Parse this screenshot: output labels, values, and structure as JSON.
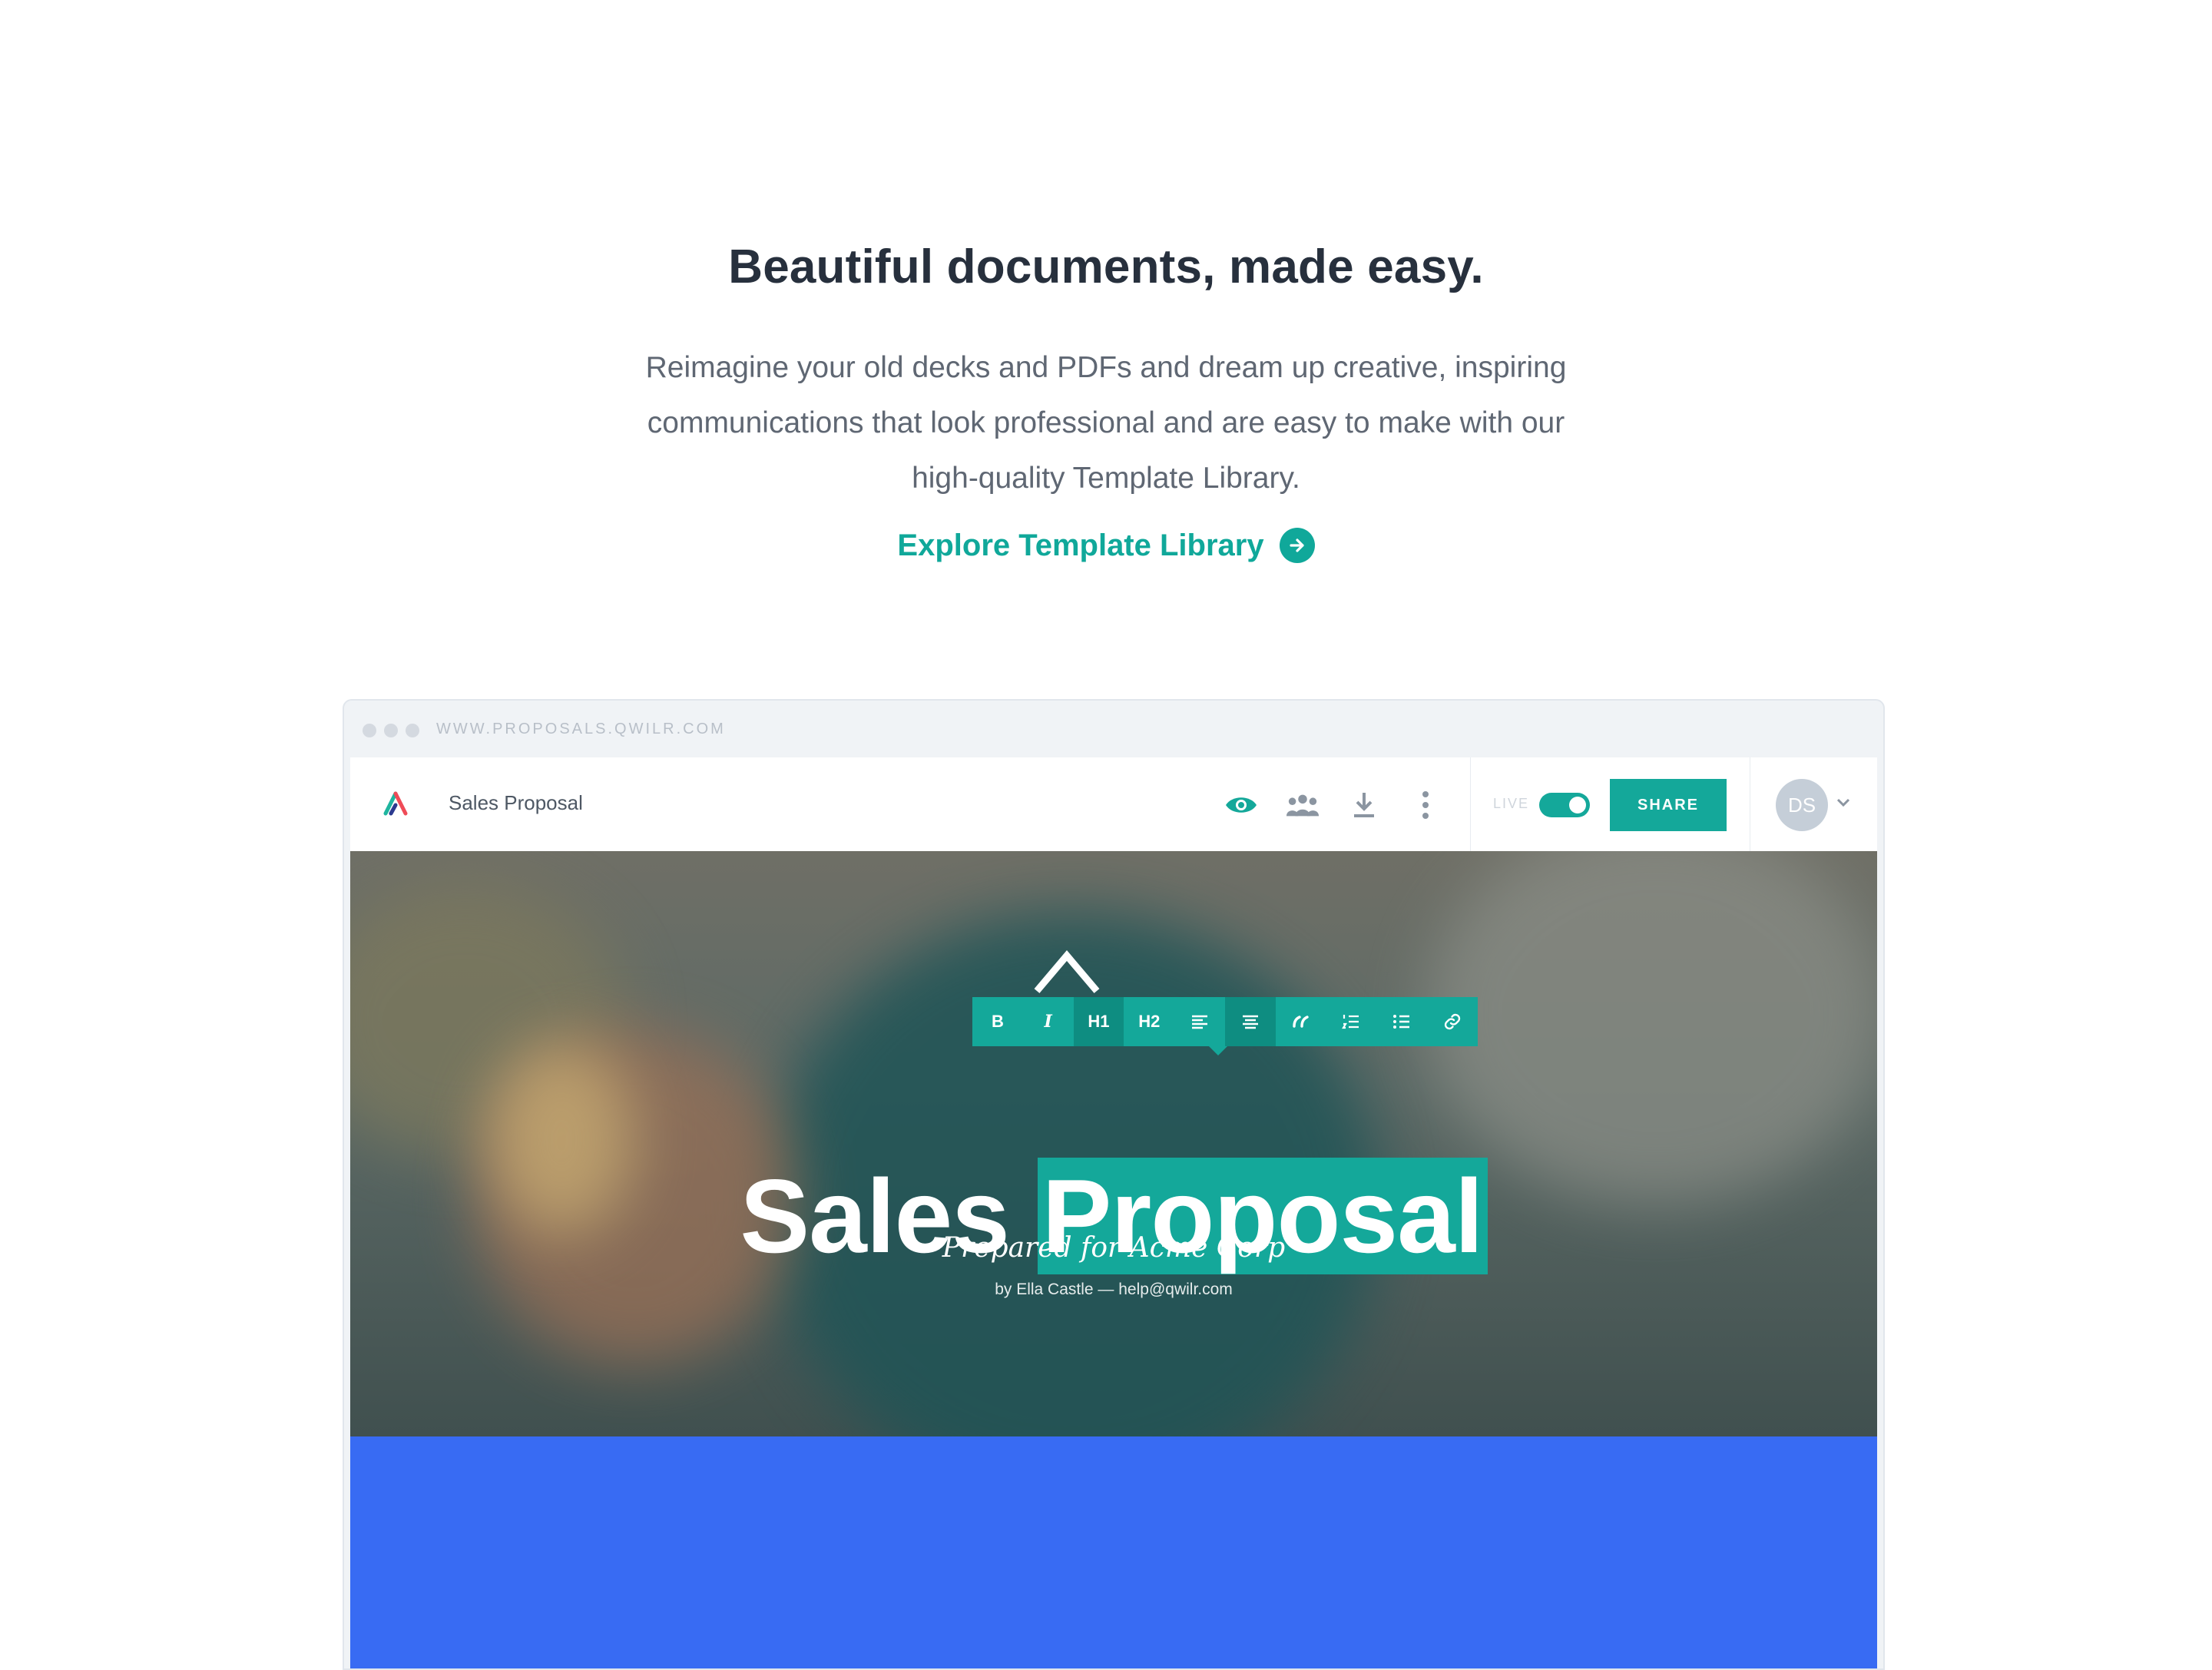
{
  "hero": {
    "title": "Beautiful documents, made easy.",
    "description": "Reimagine your old decks and PDFs and dream up creative, inspiring communications that look professional and are easy to make with our high-quality Template Library.",
    "cta_label": "Explore Template Library"
  },
  "browser": {
    "url": "WWW.PROPOSALS.QWILR.COM"
  },
  "app_header": {
    "doc_title": "Sales Proposal",
    "icons": [
      "eye-icon",
      "team-icon",
      "download-icon",
      "more-vertical-icon"
    ],
    "live_label": "LIVE",
    "live_enabled": true,
    "share_label": "SHARE",
    "avatar_initials": "DS"
  },
  "format_toolbar": {
    "buttons": [
      "B",
      "I",
      "H1",
      "H2",
      "align-left",
      "align-center",
      "quote",
      "ordered-list",
      "bullet-list",
      "link"
    ],
    "active": [
      "H1",
      "align-center"
    ]
  },
  "document": {
    "heading_plain": "Sales ",
    "heading_highlight": "Proposal",
    "subtitle": "Prepared for Acme Corp",
    "byline": "by Ella Castle —  help@qwilr.com"
  },
  "colors": {
    "accent": "#14a89a",
    "title": "#27303d",
    "blue_section": "#386bf3"
  }
}
